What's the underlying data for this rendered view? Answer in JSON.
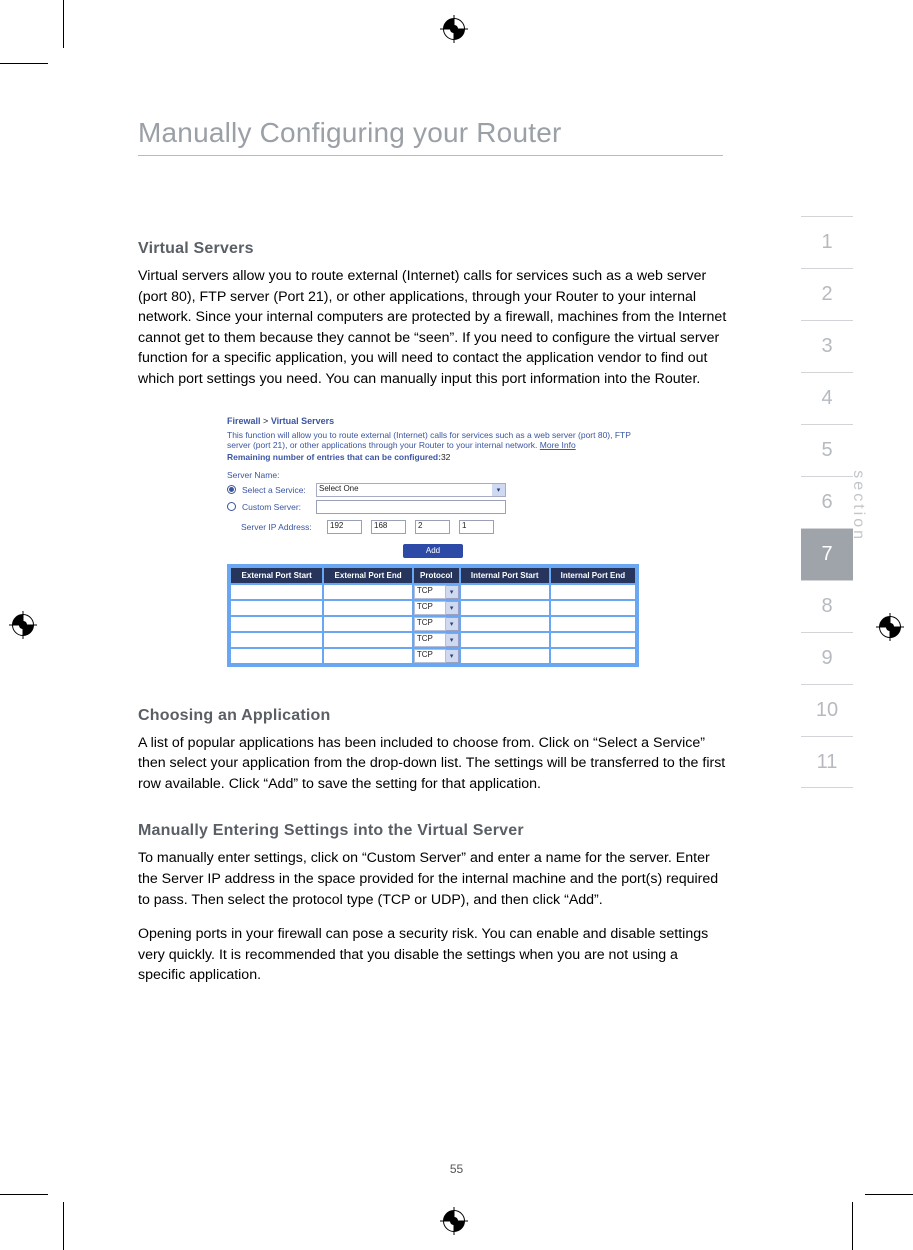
{
  "page_title": "Manually Configuring your Router",
  "page_number": "55",
  "section_label": "section",
  "tabs": [
    "1",
    "2",
    "3",
    "4",
    "5",
    "6",
    "7",
    "8",
    "9",
    "10",
    "11"
  ],
  "active_tab_index": 6,
  "virtual_servers": {
    "heading": "Virtual Servers",
    "body": "Virtual servers allow you to route external (Internet) calls for services such as a web server (port 80), FTP server (Port 21), or other applications, through your Router to your internal network. Since your internal computers are protected by a firewall, machines from the Internet cannot get to them because they cannot be “seen”. If you need to configure the virtual server function for a specific application, you will need to contact the application vendor to find out which port settings you need. You can manually input this port information into the Router."
  },
  "shot": {
    "crumb_a": "Firewall",
    "crumb_sep": ">",
    "crumb_b": "Virtual Servers",
    "desc": "This function will allow you to route external (Internet) calls for services such as a web server (port 80), FTP server (port 21), or other applications through your Router to your internal network.",
    "more_info": "More Info",
    "remaining_label": "Remaining number of entries that can be configured:",
    "remaining_value": "32",
    "server_name_label": "Server Name:",
    "select_service_label": "Select a Service:",
    "select_value": "Select One",
    "custom_server_label": "Custom Server:",
    "ip_label": "Server IP Address:",
    "ip": [
      "192",
      "168",
      "2",
      "1"
    ],
    "add_label": "Add",
    "cols": [
      "External Port Start",
      "External Port End",
      "Protocol",
      "Internal Port Start",
      "Internal Port End"
    ],
    "protocol_value": "TCP",
    "row_count": 5
  },
  "choosing": {
    "heading": "Choosing an Application",
    "body": "A list of popular applications has been included to choose from. Click on “Select a Service” then select your application from the drop-down list. The settings will be transferred to the first row available. Click “Add” to save the setting for that application."
  },
  "manual": {
    "heading": "Manually Entering Settings into the Virtual Server",
    "body1": "To manually enter settings, click on “Custom Server” and enter a name for the server. Enter the Server IP address in the space provided for the internal machine and the port(s) required to pass. Then select the protocol type (TCP or UDP), and then click “Add”.",
    "body2": "Opening ports in your firewall can pose a security risk. You can enable and disable settings very quickly. It is recommended that you disable the settings when you are not using a specific application."
  }
}
